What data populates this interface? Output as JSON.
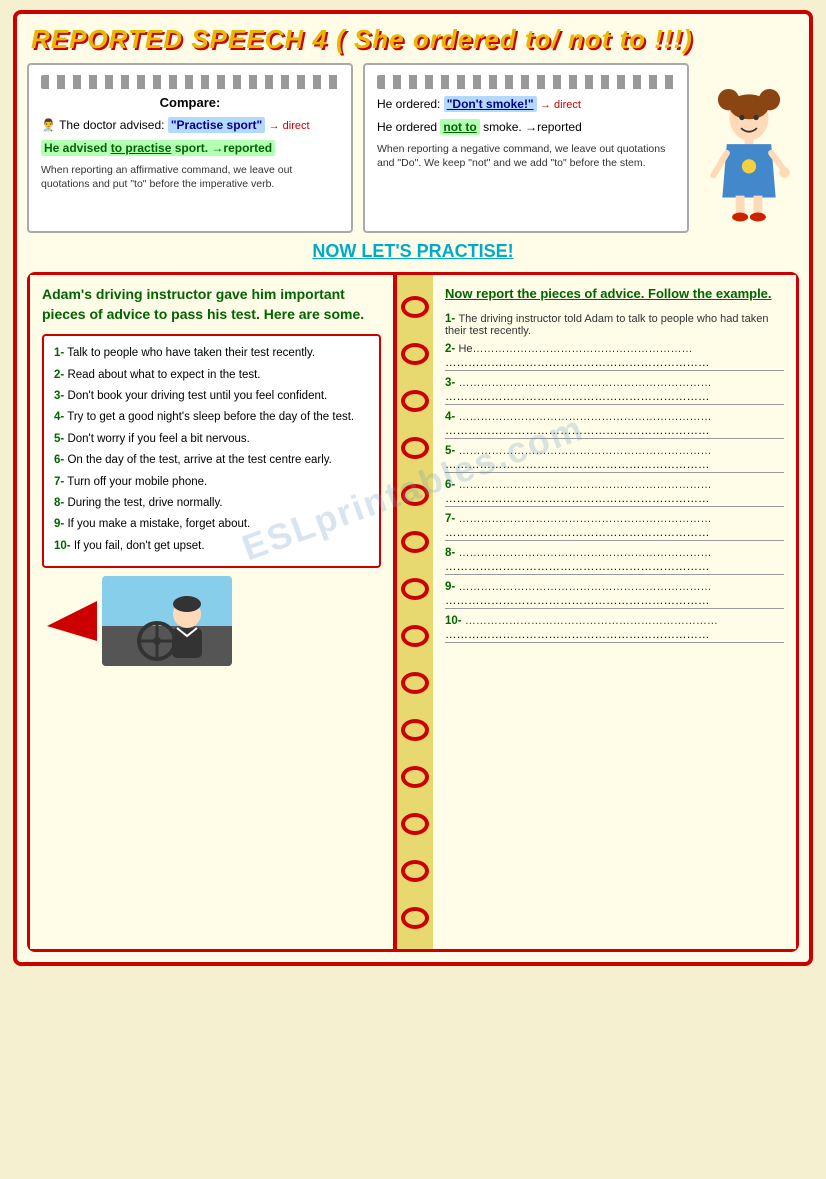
{
  "title": "REPORTED SPEECH 4 ( She ordered to/ not to !!!)",
  "subtitle": "NOW LET'S PRACTISE!",
  "card1": {
    "title": "Compare:",
    "line1_label": "The doctor advised:",
    "line1_quote": "\"Practise sport\"",
    "line1_tag": "→ direct",
    "line2_pre": "He advised",
    "line2_bold": "to practise",
    "line2_rest": " sport. →reported",
    "note": "When reporting an affirmative command, we leave out quotations and put \"to\" before the imperative verb."
  },
  "card2": {
    "line1_label": "He ordered:",
    "line1_quote": "\"Don't smoke!\"",
    "line1_tag": "→ direct",
    "line2_pre": "He ordered",
    "line2_bold": "not to",
    "line2_rest": " smoke. →reported",
    "note": "When reporting a negative command, we leave out quotations and \"Do\". We keep \"not\" and we add \"to\" before the stem."
  },
  "left_header": "Adam's driving instructor gave him important pieces of advice to pass his test. Here are some.",
  "right_header": "Now report the pieces of advice. Follow the example.",
  "advice_items": [
    {
      "num": "1-",
      "text": "Talk to people who have taken their test recently."
    },
    {
      "num": "2-",
      "text": "Read about what to expect in the test."
    },
    {
      "num": "3-",
      "text": "Don't book your driving test until you feel confident."
    },
    {
      "num": "4-",
      "text": "Try to get a good night's sleep before the day of the test."
    },
    {
      "num": "5-",
      "text": "Don't worry if you feel a bit nervous."
    },
    {
      "num": "6-",
      "text": "On the day of the test, arrive at the test centre early."
    },
    {
      "num": "7-",
      "text": "Turn off your mobile phone."
    },
    {
      "num": "8-",
      "text": "During the test, drive normally."
    },
    {
      "num": "9-",
      "text": "If you make a mistake, forget about."
    },
    {
      "num": "10-",
      "text": "If you fail, don't get upset."
    }
  ],
  "answer_items": [
    {
      "num": "1-",
      "text": "The driving instructor told Adam to talk to people who had taken their test recently.",
      "extra_line": true
    },
    {
      "num": "2-",
      "text": "He…",
      "extra_line": true,
      "show_dots": true
    },
    {
      "num": "3-",
      "text": "",
      "extra_line": true,
      "show_dots": true
    },
    {
      "num": "4-",
      "text": "",
      "extra_line": true,
      "show_dots": true
    },
    {
      "num": "5-",
      "text": "",
      "extra_line": true,
      "show_dots": true
    },
    {
      "num": "6-",
      "text": "",
      "extra_line": true,
      "show_dots": true
    },
    {
      "num": "7-",
      "text": "",
      "extra_line": true,
      "show_dots": true
    },
    {
      "num": "8-",
      "text": "",
      "extra_line": true,
      "show_dots": true
    },
    {
      "num": "9-",
      "text": "",
      "extra_line": true,
      "show_dots": true
    },
    {
      "num": "10-",
      "text": "",
      "extra_line": true,
      "show_dots": true
    }
  ],
  "spiral_count": 14,
  "watermark": "ESLprintables.com"
}
